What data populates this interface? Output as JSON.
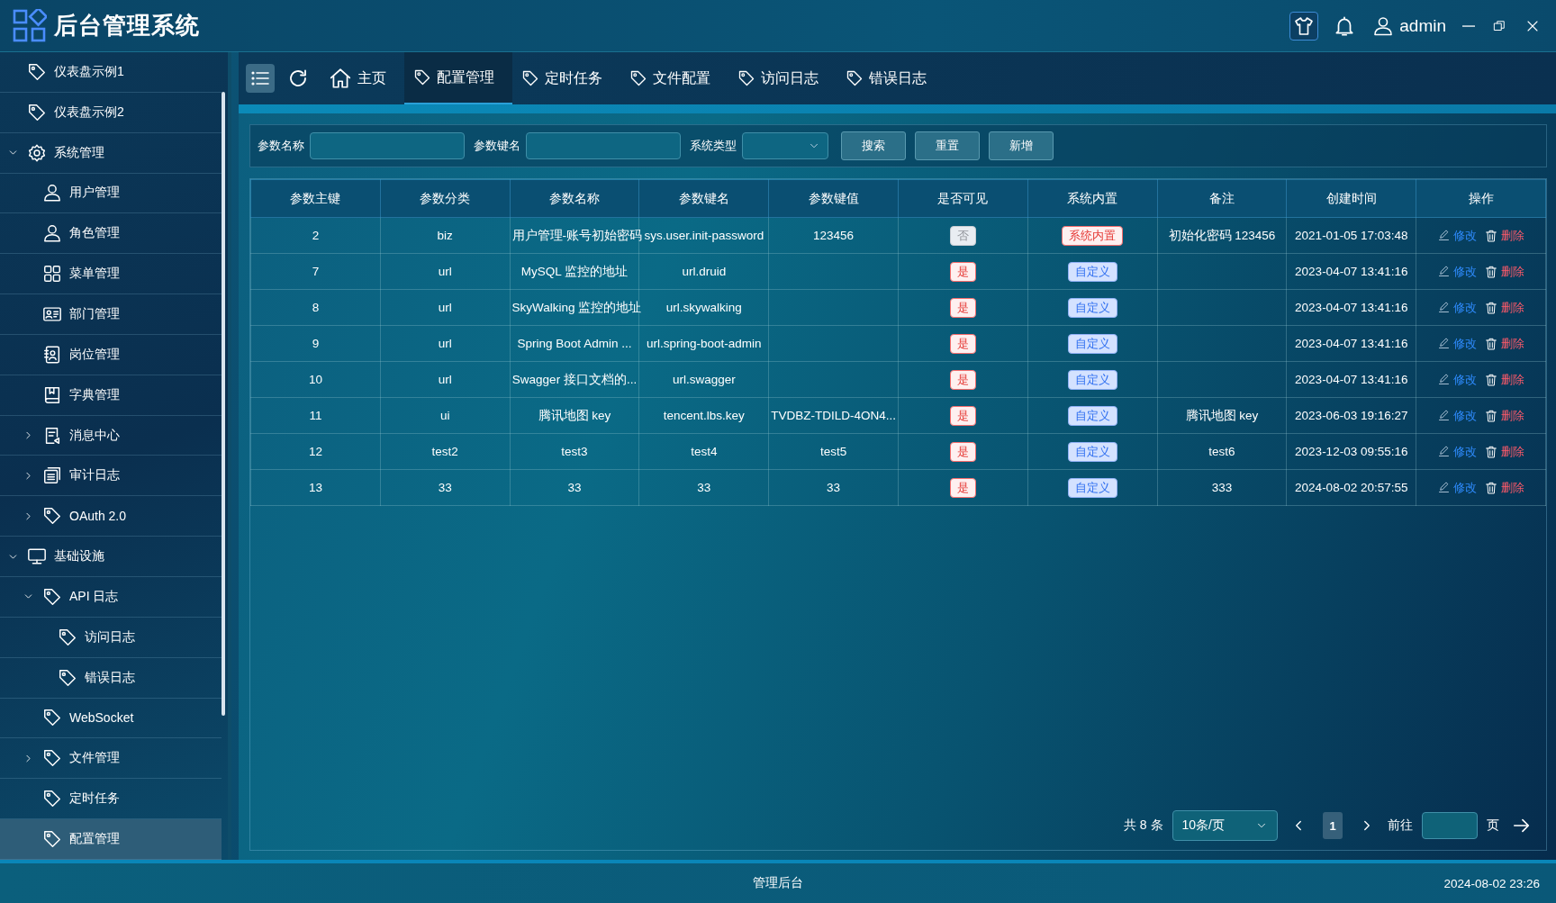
{
  "header": {
    "title": "后台管理系统",
    "user": "admin"
  },
  "sidebar": {
    "items": [
      {
        "label": "仪表盘示例1",
        "kind": "tag",
        "selected": false
      },
      {
        "label": "仪表盘示例2",
        "kind": "tag",
        "selected": false
      },
      {
        "label": "系统管理",
        "kind": "gear",
        "selected": false,
        "expanded": true,
        "children": [
          {
            "label": "用户管理",
            "kind": "user",
            "selected": false
          },
          {
            "label": "角色管理",
            "kind": "user",
            "selected": false
          },
          {
            "label": "菜单管理",
            "kind": "grid",
            "selected": false
          },
          {
            "label": "部门管理",
            "kind": "id-card",
            "selected": false
          },
          {
            "label": "岗位管理",
            "kind": "contact",
            "selected": false
          },
          {
            "label": "字典管理",
            "kind": "book",
            "selected": false
          },
          {
            "label": "消息中心",
            "kind": "message",
            "selected": false,
            "expanded": false
          },
          {
            "label": "审计日志",
            "kind": "docs",
            "selected": false,
            "expanded": false
          },
          {
            "label": "OAuth 2.0",
            "kind": "tag",
            "selected": false,
            "expanded": false
          }
        ]
      },
      {
        "label": "基础设施",
        "kind": "monitor",
        "selected": false,
        "expanded": true,
        "children": [
          {
            "label": "API 日志",
            "kind": "tag",
            "selected": false,
            "expanded": true,
            "children": [
              {
                "label": "访问日志",
                "kind": "tag",
                "selected": false
              },
              {
                "label": "错误日志",
                "kind": "tag",
                "selected": false
              }
            ]
          },
          {
            "label": "WebSocket",
            "kind": "tag",
            "selected": false
          },
          {
            "label": "文件管理",
            "kind": "tag",
            "selected": false,
            "expanded": false
          },
          {
            "label": "定时任务",
            "kind": "tag",
            "selected": false
          },
          {
            "label": "配置管理",
            "kind": "tag",
            "selected": true
          }
        ]
      }
    ]
  },
  "tabs": [
    {
      "label": "主页",
      "kind": "home",
      "selected": false
    },
    {
      "label": "配置管理",
      "kind": "tag",
      "selected": true
    },
    {
      "label": "定时任务",
      "kind": "tag",
      "selected": false
    },
    {
      "label": "文件配置",
      "kind": "tag",
      "selected": false
    },
    {
      "label": "访问日志",
      "kind": "tag",
      "selected": false
    },
    {
      "label": "错误日志",
      "kind": "tag",
      "selected": false
    }
  ],
  "search": {
    "fields": [
      {
        "label": "参数名称",
        "kind": "input"
      },
      {
        "label": "参数键名",
        "kind": "input"
      },
      {
        "label": "系统类型",
        "kind": "select"
      }
    ],
    "buttons": [
      "搜索",
      "重置",
      "新增"
    ]
  },
  "table": {
    "columns": [
      "参数主键",
      "参数分类",
      "参数名称",
      "参数键名",
      "参数键值",
      "是否可见",
      "系统内置",
      "备注",
      "创建时间",
      "操作"
    ],
    "rows": [
      {
        "id": "2",
        "category": "biz",
        "name": "用户管理-账号初始密码",
        "key": "sys.user.init-password",
        "value": "123456",
        "visible": {
          "text": "否",
          "kind": "info"
        },
        "builtin": {
          "text": "系统内置",
          "kind": "danger"
        },
        "remark": "初始化密码 123456",
        "created": "2021-01-05 17:03:48",
        "actions": [
          "修改",
          "删除"
        ]
      },
      {
        "id": "7",
        "category": "url",
        "name": "MySQL 监控的地址",
        "key": "url.druid",
        "visible": {
          "text": "是",
          "kind": "danger"
        },
        "builtin": {
          "text": "自定义",
          "kind": "primary"
        },
        "created": "2023-04-07 13:41:16",
        "actions": [
          "修改",
          "删除"
        ]
      },
      {
        "id": "8",
        "category": "url",
        "name": "SkyWalking 监控的地址",
        "key": "url.skywalking",
        "visible": {
          "text": "是",
          "kind": "danger"
        },
        "builtin": {
          "text": "自定义",
          "kind": "primary"
        },
        "created": "2023-04-07 13:41:16",
        "actions": [
          "修改",
          "删除"
        ]
      },
      {
        "id": "9",
        "category": "url",
        "name": "Spring Boot Admin ...",
        "key": "url.spring-boot-admin",
        "visible": {
          "text": "是",
          "kind": "danger"
        },
        "builtin": {
          "text": "自定义",
          "kind": "primary"
        },
        "created": "2023-04-07 13:41:16",
        "actions": [
          "修改",
          "删除"
        ]
      },
      {
        "id": "10",
        "category": "url",
        "name": "Swagger 接口文档的...",
        "key": "url.swagger",
        "visible": {
          "text": "是",
          "kind": "danger"
        },
        "builtin": {
          "text": "自定义",
          "kind": "primary"
        },
        "created": "2023-04-07 13:41:16",
        "actions": [
          "修改",
          "删除"
        ]
      },
      {
        "id": "11",
        "category": "ui",
        "name": "腾讯地图 key",
        "key": "tencent.lbs.key",
        "value": "TVDBZ-TDILD-4ON4...",
        "visible": {
          "text": "是",
          "kind": "danger"
        },
        "builtin": {
          "text": "自定义",
          "kind": "primary"
        },
        "remark": "腾讯地图 key",
        "created": "2023-06-03 19:16:27",
        "actions": [
          "修改",
          "删除"
        ]
      },
      {
        "id": "12",
        "category": "test2",
        "name": "test3",
        "key": "test4",
        "value": "test5",
        "visible": {
          "text": "是",
          "kind": "danger"
        },
        "builtin": {
          "text": "自定义",
          "kind": "primary"
        },
        "remark": "test6",
        "created": "2023-12-03 09:55:16",
        "actions": [
          "修改",
          "删除"
        ]
      },
      {
        "id": "13",
        "category": "33",
        "name": "33",
        "key": "33",
        "value": "33",
        "visible": {
          "text": "是",
          "kind": "danger"
        },
        "builtin": {
          "text": "自定义",
          "kind": "primary"
        },
        "remark": "333",
        "created": "2024-08-02 20:57:55",
        "actions": [
          "修改",
          "删除"
        ]
      }
    ]
  },
  "pager": {
    "total": "共 8 条",
    "page_size": "10条/页",
    "pages": [
      {
        "label": "1",
        "selected": true
      }
    ],
    "goto_label": "前往",
    "goto_suffix": "页"
  },
  "footer": {
    "text": "管理后台",
    "datetime": "2024-08-02 23:26"
  }
}
